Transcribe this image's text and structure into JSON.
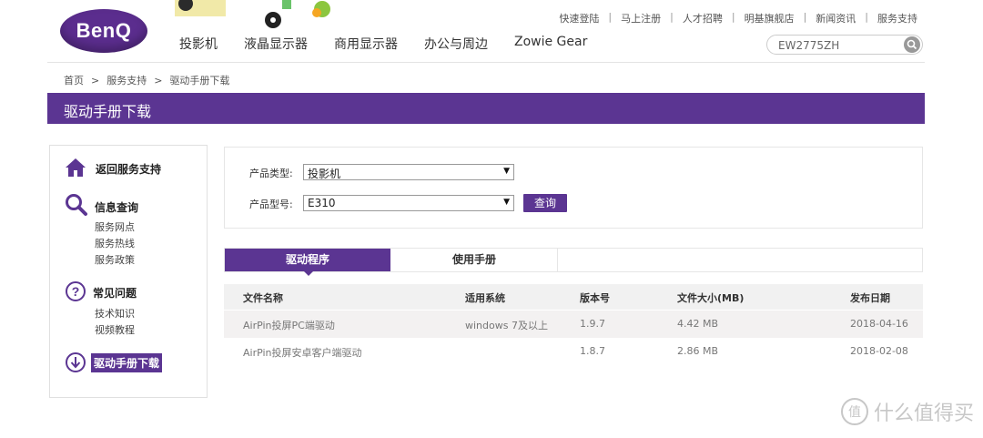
{
  "header": {
    "logo_text": "BenQ",
    "top_links": [
      "快速登陆",
      "马上注册",
      "人才招聘",
      "明基旗舰店",
      "新闻资讯",
      "服务支持"
    ],
    "nav": [
      "投影机",
      "液晶显示器",
      "商用显示器",
      "办公与周边",
      "Zowie Gear"
    ],
    "search_value": "EW2775ZH"
  },
  "breadcrumb": [
    "首页",
    "服务支持",
    "驱动手册下载"
  ],
  "breadcrumb_sep": ">",
  "page_title": "驱动手册下载",
  "sidebar": {
    "back": "返回服务支持",
    "info_title": "信息查询",
    "info_items": [
      "服务网点",
      "服务热线",
      "服务政策"
    ],
    "faq_title": "常见问题",
    "faq_items": [
      "技术知识",
      "视频教程"
    ],
    "download": "驱动手册下载"
  },
  "filter": {
    "type_label": "产品类型:",
    "type_value": "投影机",
    "model_label": "产品型号:",
    "model_value": "E310",
    "query_button": "查询"
  },
  "tabs": [
    "驱动程序",
    "使用手册"
  ],
  "table": {
    "columns": [
      "文件名称",
      "适用系统",
      "版本号",
      "文件大小(MB)",
      "发布日期"
    ],
    "rows": [
      [
        "AirPin投屏PC端驱动",
        "windows 7及以上",
        "1.9.7",
        "4.42 MB",
        "2018-04-16"
      ],
      [
        "AirPin投屏安卓客户端驱动",
        "",
        "1.8.7",
        "2.86 MB",
        "2018-02-08"
      ]
    ]
  },
  "watermark": "什么值得买",
  "colors": {
    "brand_purple": "#5b3592",
    "logo_purple": "#5b2d8e"
  }
}
